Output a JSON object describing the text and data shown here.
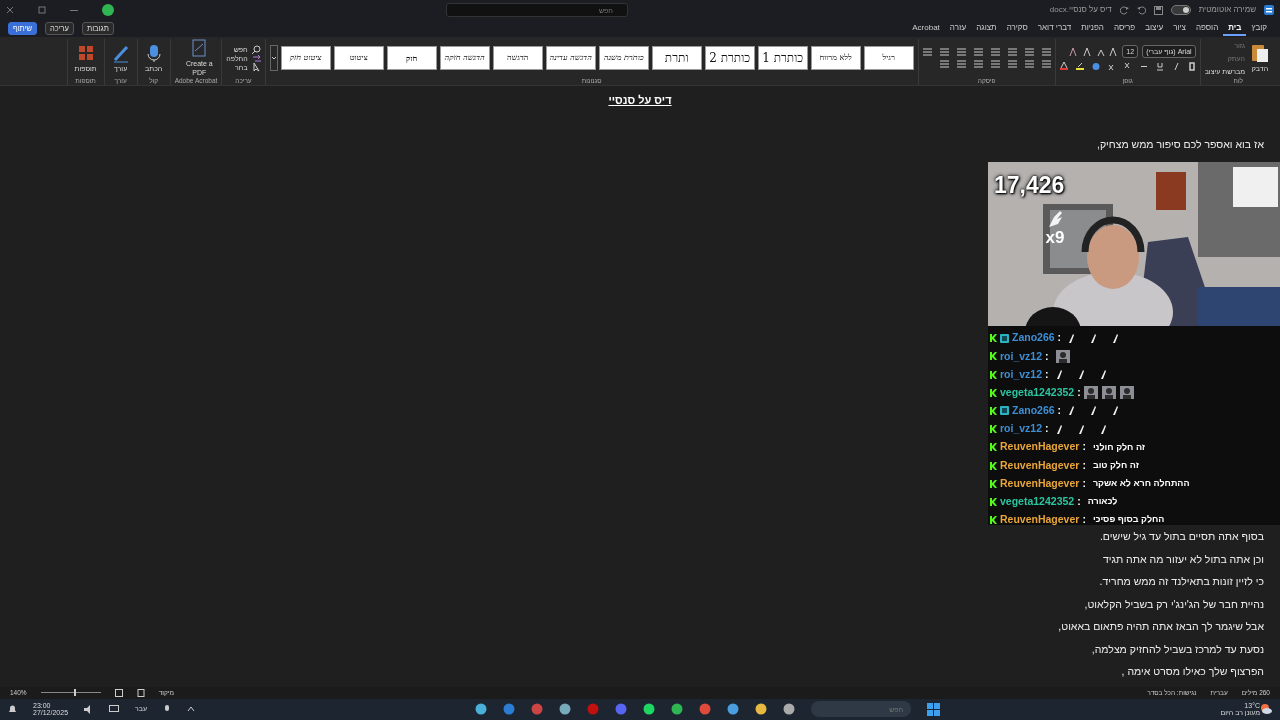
{
  "title_bar": {
    "autosave_label": "שמירה אוטומטית",
    "autosave_on": false,
    "doc_name": "דיס על סנסיי.docx",
    "search_placeholder": "חפש"
  },
  "menu_tabs": [
    {
      "label": "קובץ",
      "selected": false
    },
    {
      "label": "בית",
      "selected": true
    },
    {
      "label": "הוספה",
      "selected": false
    },
    {
      "label": "ציור",
      "selected": false
    },
    {
      "label": "עיצוב",
      "selected": false
    },
    {
      "label": "פריסה",
      "selected": false
    },
    {
      "label": "הפניות",
      "selected": false
    },
    {
      "label": "דברי דואר",
      "selected": false
    },
    {
      "label": "סקירה",
      "selected": false
    },
    {
      "label": "תצוגה",
      "selected": false
    },
    {
      "label": "עזרה",
      "selected": false
    },
    {
      "label": "Acrobat",
      "selected": false
    }
  ],
  "tab_actions": [
    {
      "kind": "comments",
      "label": "תגובות"
    },
    {
      "kind": "editing",
      "label": "עריכה"
    },
    {
      "kind": "share",
      "label": "שיתוף"
    }
  ],
  "ribbon": {
    "clipboard": {
      "label": "לוח",
      "paste": "הדבק",
      "cut": "גזור",
      "copy": "העתק",
      "format_painter": "מברשת עיצוב"
    },
    "font": {
      "label": "גופן",
      "font_name": "Arial (גוף עברי)",
      "font_size": "12"
    },
    "paragraph": {
      "label": "פיסקה"
    },
    "styles": {
      "label": "סגנונות",
      "items": [
        "רגיל",
        "ללא מרווח",
        "כותרת 1",
        "כותרת 2",
        "ותרת",
        "כותרת משנה",
        "הדגשה עדינה",
        "הדגשה",
        "הדגשה חזקה",
        "חזק",
        "ציטוט",
        "ציטוט חזק"
      ]
    },
    "editing": {
      "label": "עריכה",
      "items": [
        {
          "kind": "find",
          "label": "חפש"
        },
        {
          "kind": "replace",
          "label": "החלפה"
        },
        {
          "kind": "select",
          "label": "בחר"
        }
      ]
    },
    "big_groups": [
      {
        "kind": "pdf",
        "label": "Create a PDF",
        "group": "Adobe Acrobat"
      },
      {
        "kind": "dictate",
        "label": "הכתב",
        "group": "קול"
      },
      {
        "kind": "editor",
        "label": "עורך",
        "group": "עורך"
      },
      {
        "kind": "addins",
        "label": "תוספות",
        "group": "תוספות"
      }
    ]
  },
  "document": {
    "title": "דיס על סנסיי",
    "lines_top": [
      "אז בוא ואספר לכם סיפור ממש מצחיק,"
    ],
    "lines_bottom": [
      "בסוף אתה תסיים בתול עד גיל שישים.",
      "וכן אתה בתול לא יעזור מה אתה תגיד",
      "כי לזיין זונות בתאילנד זה ממש מחריד.",
      "נהיית חבר של הג'ינג'י רק בשביל הקלאוט,",
      "אבל שיגמר לך הבאז אתה תהיה פתאום באאוט,",
      "נסעת עד למרכז בשביל להחזיק מצלמה,",
      "הפרצוף שלך כאילו מסרט אימה ,"
    ]
  },
  "stream": {
    "counter": "17,426",
    "multiplier": "x9",
    "chat": [
      {
        "user": "Zano266",
        "separator": ":",
        "color": "#3d8fd6",
        "extra_badge": true,
        "kind": "quills"
      },
      {
        "user": "roi_vz12",
        "separator": ":",
        "color": "#3d8fd6",
        "extra_badge": false,
        "kind": "avatar"
      },
      {
        "user": "roi_vz12",
        "separator": ":",
        "color": "#3d8fd6",
        "extra_badge": false,
        "kind": "quills"
      },
      {
        "user": "vegeta1242352",
        "separator": ":",
        "color": "#2ec4a0",
        "extra_badge": false,
        "kind": "avatars"
      },
      {
        "user": "Zano266",
        "separator": ":",
        "color": "#3d8fd6",
        "extra_badge": true,
        "kind": "quills"
      },
      {
        "user": "roi_vz12",
        "separator": ":",
        "color": "#3d8fd6",
        "extra_badge": false,
        "kind": "quills"
      },
      {
        "user": "ReuvenHagever",
        "separator": ":",
        "color": "#e8a53a",
        "extra_badge": false,
        "kind": "text",
        "text": "זה חלק חולני"
      },
      {
        "user": "ReuvenHagever",
        "separator": ":",
        "color": "#e8a53a",
        "extra_badge": false,
        "kind": "text",
        "text": "זה חלק טוב"
      },
      {
        "user": "ReuvenHagever",
        "separator": ":",
        "color": "#e8a53a",
        "extra_badge": false,
        "kind": "text",
        "text": "ההתחלה חרא לא אשקר"
      },
      {
        "user": "vegeta1242352",
        "separator": ":",
        "color": "#2ec4a0",
        "extra_badge": false,
        "kind": "text",
        "text": "לכאורה"
      },
      {
        "user": "ReuvenHagever",
        "separator": ":",
        "color": "#e8a53a",
        "extra_badge": false,
        "kind": "text",
        "text": "החלק בסוף פסיכי"
      }
    ]
  },
  "status_bar": {
    "words": "260 מילים",
    "language": "עברית",
    "accessibility": "נגישות: הכל בסדר",
    "focus": "מיקוד",
    "zoom": "140%",
    "zoom_slider": {
      "level": 0.55
    }
  },
  "taskbar": {
    "search_placeholder": "חפש",
    "weather_temp": "13°C",
    "weather_text": "מעונן רב היום",
    "input_lang": "עבר",
    "time": "23:00",
    "date": "27/12/2025"
  }
}
